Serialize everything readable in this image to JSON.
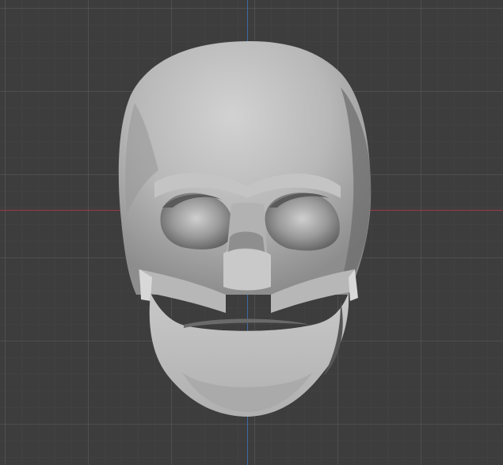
{
  "viewport": {
    "grid_color": "#5a5a5a",
    "background_color": "#3d3d3d",
    "axis_x_color": "#9c3a45",
    "axis_y_color": "#3f6aa3"
  },
  "model": {
    "object": "skull-icon",
    "base_color": "#bdbdbd"
  }
}
